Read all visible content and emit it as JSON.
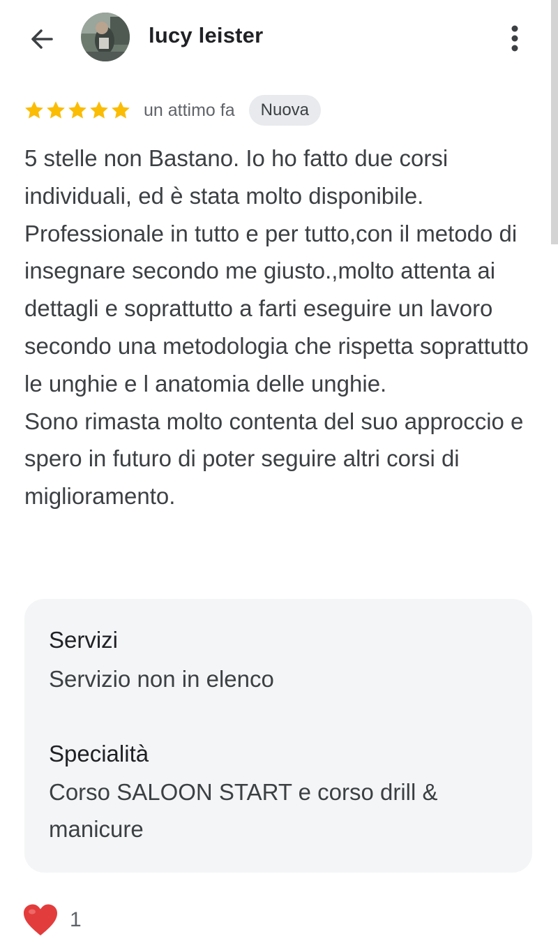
{
  "header": {
    "author_name": "lucy leister",
    "back_icon": "arrow-back-icon",
    "more_icon": "more-vertical-icon"
  },
  "review": {
    "rating": 5,
    "max_rating": 5,
    "time": "un attimo fa",
    "badge": "Nuova",
    "text": "5 stelle non Bastano. Io ho fatto due corsi individuali, ed è stata molto disponibile. Professionale in tutto e per tutto,con il metodo di insegnare secondo me giusto.,molto attenta ai dettagli e soprattutto a farti eseguire un lavoro secondo una metodologia che rispetta soprattutto le unghie e l anatomia delle unghie.\nSono rimasta molto contenta del suo approccio e spero in futuro di poter seguire altri corsi di miglioramento."
  },
  "details": {
    "services_label": "Servizi",
    "services_value": "Servizio non in elenco",
    "specialty_label": "Specialità",
    "specialty_value": "Corso SALOON START e corso drill & manicure"
  },
  "reactions": {
    "icon": "heart-icon",
    "count": "1"
  },
  "colors": {
    "star": "#fbbc04",
    "heart": "#e33c3c",
    "badge_bg": "#e8eaed",
    "card_bg": "#f4f5f7"
  }
}
